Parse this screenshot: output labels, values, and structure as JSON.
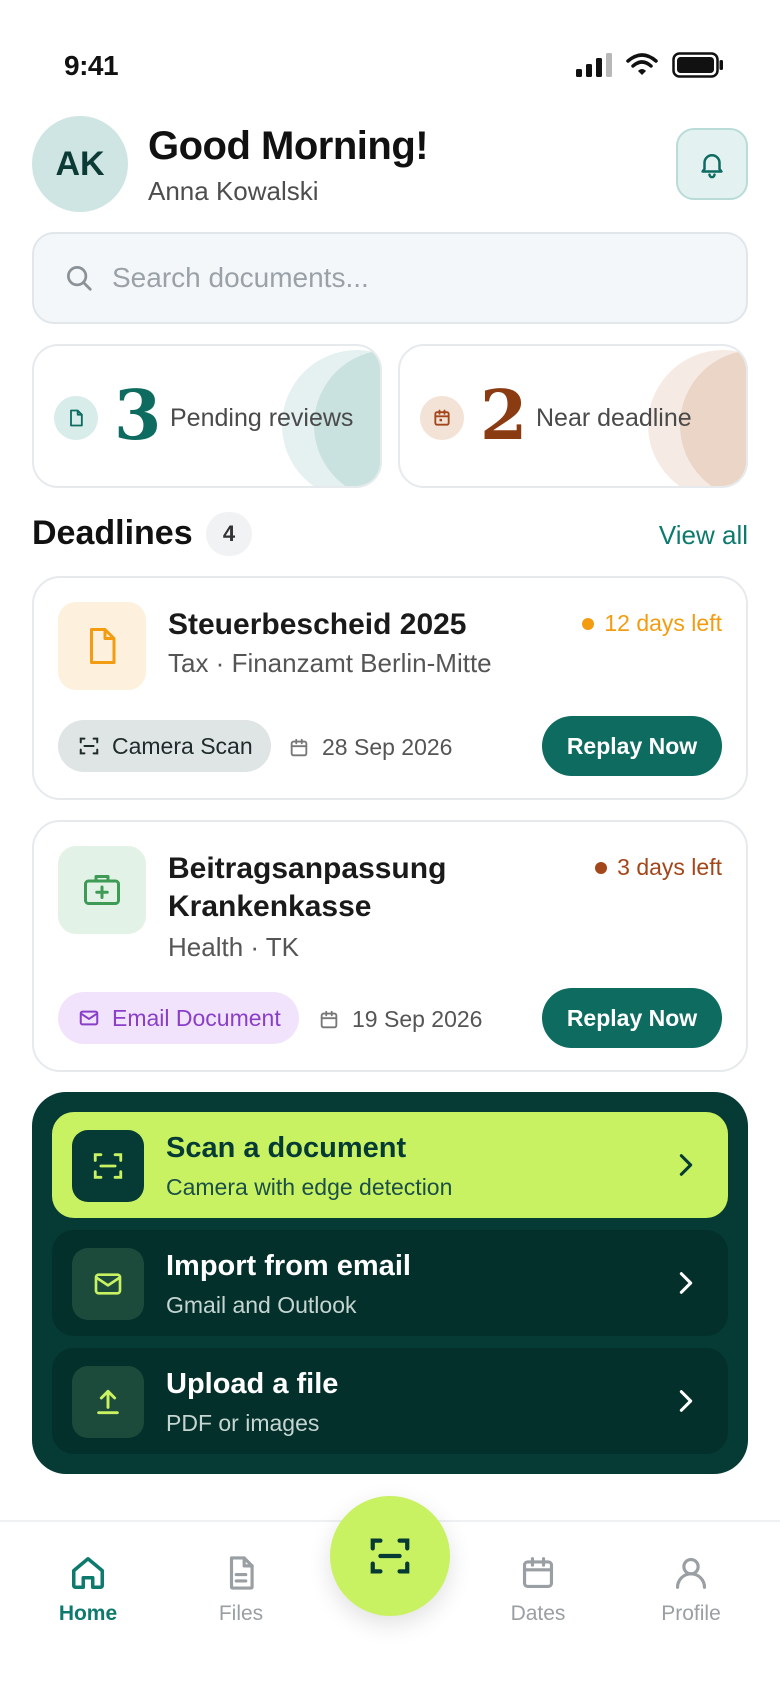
{
  "status_bar": {
    "time": "9:41"
  },
  "header": {
    "avatar_initials": "AK",
    "greeting": "Good Morning!",
    "user_name": "Anna Kowalski"
  },
  "search": {
    "placeholder": "Search documents..."
  },
  "stats": [
    {
      "number": "3",
      "label": "Pending reviews",
      "icon": "document-icon",
      "accent": "#0d6b60"
    },
    {
      "number": "2",
      "label": "Near deadline",
      "icon": "calendar-icon",
      "accent": "#8a3b12"
    }
  ],
  "deadlines": {
    "title": "Deadlines",
    "count": "4",
    "view_all": "View all",
    "items": [
      {
        "title": "Steuerbescheid 2025",
        "meta": "Tax · Finanzamt Berlin-Mitte",
        "due": "12 days left",
        "due_color": "#f39c12",
        "icon": "document-icon",
        "tag": "Camera Scan",
        "tag_icon": "scan-icon",
        "date": "28 Sep 2026",
        "action": "Replay Now"
      },
      {
        "title_line1": "Beitragsanpassung",
        "title_line2": "Krankenkasse",
        "meta": "Health · TK",
        "due": "3 days left",
        "due_color": "#a3461a",
        "icon": "medical-kit-icon",
        "tag": "Email Document",
        "tag_icon": "mail-icon",
        "date": "19 Sep 2026",
        "action": "Replay Now"
      }
    ]
  },
  "actions": [
    {
      "title": "Scan a document",
      "subtitle": "Camera with edge detection",
      "icon": "scan-icon"
    },
    {
      "title": "Import from email",
      "subtitle": "Gmail and Outlook",
      "icon": "mail-icon"
    },
    {
      "title": "Upload a file",
      "subtitle": "PDF or images",
      "icon": "upload-icon"
    }
  ],
  "nav": {
    "home": "Home",
    "files": "Files",
    "dates": "Dates",
    "profile": "Profile",
    "active": "home"
  },
  "colors": {
    "brand": "#0d6b60",
    "lime": "#c8f262",
    "panel": "#063a34"
  }
}
